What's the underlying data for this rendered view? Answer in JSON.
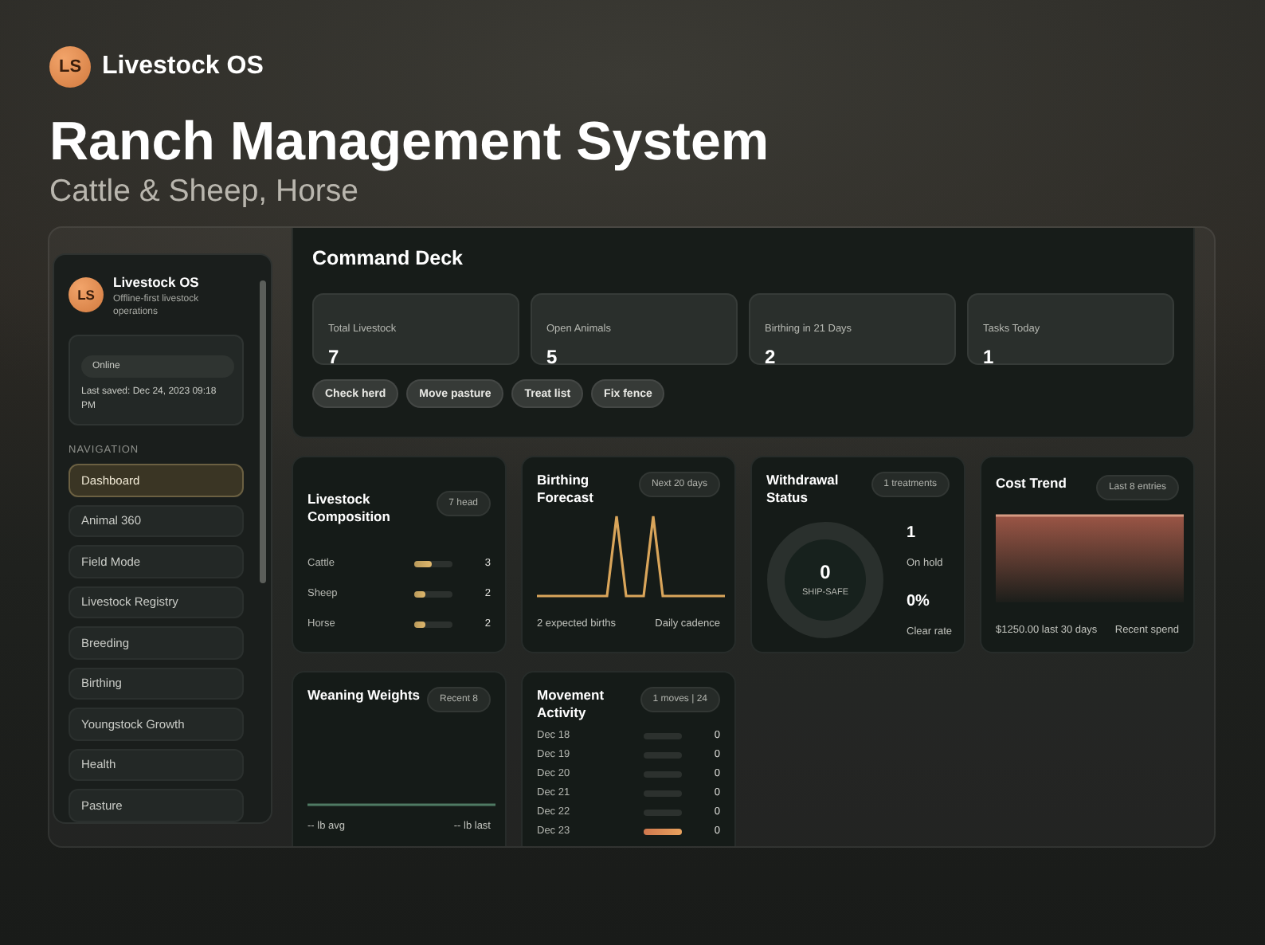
{
  "brand": {
    "initials": "LS",
    "name": "Livestock OS"
  },
  "title": "Ranch Management System",
  "subtitle": "Cattle & Sheep, Horse",
  "sidebar": {
    "initials": "LS",
    "name": "Livestock OS",
    "tagline": "Offline-first livestock operations",
    "status": "Online",
    "last_saved": "Last saved: Dec 24, 2023 09:18 PM",
    "nav_heading": "NAVIGATION",
    "items": [
      {
        "label": "Dashboard",
        "selected": true
      },
      {
        "label": "Animal 360",
        "selected": false
      },
      {
        "label": "Field Mode",
        "selected": false
      },
      {
        "label": "Livestock Registry",
        "selected": false
      },
      {
        "label": "Breeding",
        "selected": false
      },
      {
        "label": "Birthing",
        "selected": false
      },
      {
        "label": "Youngstock Growth",
        "selected": false
      },
      {
        "label": "Health",
        "selected": false
      },
      {
        "label": "Pasture",
        "selected": false
      }
    ]
  },
  "command_deck": {
    "title": "Command Deck",
    "stats": [
      {
        "label": "Total Livestock",
        "value": "7"
      },
      {
        "label": "Open Animals",
        "value": "5"
      },
      {
        "label": "Birthing in 21 Days",
        "value": "2"
      },
      {
        "label": "Tasks Today",
        "value": "1"
      }
    ],
    "actions": [
      "Check herd",
      "Move pasture",
      "Treat list",
      "Fix fence"
    ]
  },
  "composition": {
    "title": "Livestock Composition",
    "badge": "7 head",
    "rows": [
      {
        "label": "Cattle",
        "level": 0.45,
        "count": "3"
      },
      {
        "label": "Sheep",
        "level": 0.3,
        "count": "2"
      },
      {
        "label": "Horse",
        "level": 0.3,
        "count": "2"
      }
    ]
  },
  "birthing_forecast": {
    "title": "Birthing Forecast",
    "badge": "Next 20 days",
    "footer_left": "2 expected births",
    "footer_right": "Daily cadence"
  },
  "withdrawal": {
    "title": "Withdrawal Status",
    "badge": "1 treatments",
    "center_value": "0",
    "center_label": "SHIP-SAFE",
    "stats": [
      {
        "value": "1",
        "label": "On hold"
      },
      {
        "value": "0%",
        "label": "Clear rate"
      }
    ]
  },
  "cost_trend": {
    "title": "Cost Trend",
    "badge": "Last 8 entries",
    "footer_left": "$1250.00 last 30 days",
    "footer_right": "Recent spend"
  },
  "weaning": {
    "title": "Weaning Weights",
    "badge": "Recent 8",
    "footer_left": "-- lb avg",
    "footer_right": "-- lb last"
  },
  "movement": {
    "title": "Movement Activity",
    "badge": "1 moves | 24",
    "rows": [
      {
        "label": "Dec 18",
        "level": 0,
        "count": "0"
      },
      {
        "label": "Dec 19",
        "level": 0,
        "count": "0"
      },
      {
        "label": "Dec 20",
        "level": 0,
        "count": "0"
      },
      {
        "label": "Dec 21",
        "level": 0,
        "count": "0"
      },
      {
        "label": "Dec 22",
        "level": 0,
        "count": "0"
      },
      {
        "label": "Dec 23",
        "level": 1,
        "count": "0"
      }
    ]
  }
}
